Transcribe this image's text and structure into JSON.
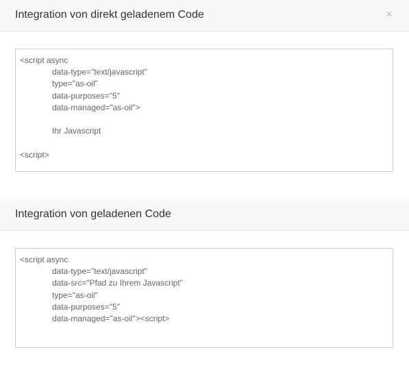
{
  "sections": [
    {
      "title": "Integration von direkt geladenem Code",
      "close_symbol": "×",
      "code": [
        {
          "text": "<script async",
          "indent": false
        },
        {
          "text": "data-type=\"text/javascript\"",
          "indent": true
        },
        {
          "text": "type=\"as-oil\"",
          "indent": true
        },
        {
          "text": "data-purposes=\"5\"",
          "indent": true
        },
        {
          "text": "data-managed=\"as-oil\">",
          "indent": true
        },
        {
          "text": "",
          "indent": false
        },
        {
          "text": "Ihr Javascript",
          "indent": true
        },
        {
          "text": "",
          "indent": false
        },
        {
          "text": "<script>",
          "indent": false
        }
      ]
    },
    {
      "title": "Integration von geladenen Code",
      "code": [
        {
          "text": "<script async",
          "indent": false
        },
        {
          "text": "data-type=\"text/javascript\"",
          "indent": true
        },
        {
          "text": "data-src=\"Pfad zu Ihrem Javascript\"",
          "indent": true
        },
        {
          "text": "type=\"as-oil\"",
          "indent": true
        },
        {
          "text": "data-purposes=\"5\"",
          "indent": true
        },
        {
          "text": "data-managed=\"as-oil\"><script>",
          "indent": true
        }
      ]
    }
  ]
}
